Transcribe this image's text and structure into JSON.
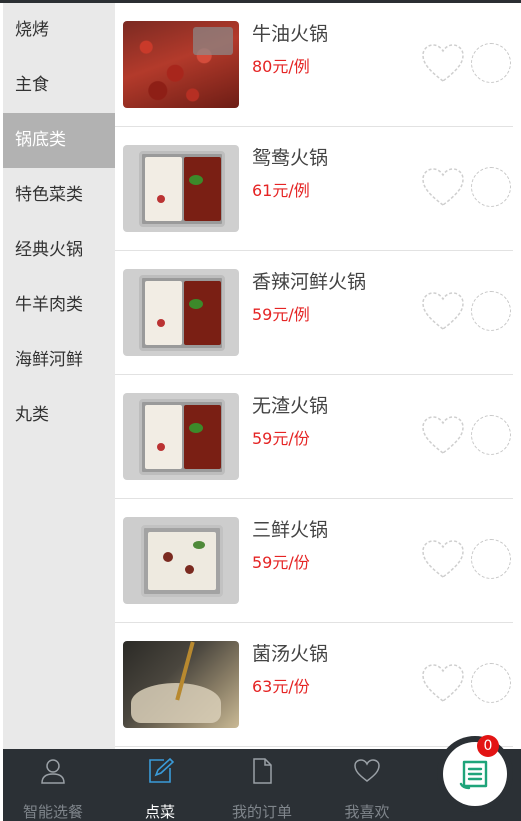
{
  "sidebar": {
    "categories": [
      {
        "label": "烧烤"
      },
      {
        "label": "主食"
      },
      {
        "label": "锅底类"
      },
      {
        "label": "特色菜类"
      },
      {
        "label": "经典火锅"
      },
      {
        "label": "牛羊肉类"
      },
      {
        "label": "海鲜河鲜"
      },
      {
        "label": "丸类"
      }
    ],
    "active": "锅底类"
  },
  "dishes": [
    {
      "name": "牛油火锅",
      "price": "80元/例",
      "image": "crayfish-hotpot-photo"
    },
    {
      "name": "鸳鸯火锅",
      "price": "61元/例",
      "image": "yuanyang-hotpot-photo"
    },
    {
      "name": "香辣河鲜火锅",
      "price": "59元/例",
      "image": "yuanyang-hotpot-photo"
    },
    {
      "name": "无渣火锅",
      "price": "59元/份",
      "image": "yuanyang-hotpot-photo"
    },
    {
      "name": "三鲜火锅",
      "price": "59元/份",
      "image": "sanxian-hotpot-photo"
    },
    {
      "name": "菌汤火锅",
      "price": "63元/份",
      "image": "mushroom-soup-photo"
    }
  ],
  "bottom_nav": {
    "items": [
      {
        "label": "智能选餐",
        "icon": "person-icon"
      },
      {
        "label": "点菜",
        "icon": "edit-icon"
      },
      {
        "label": "我的订单",
        "icon": "document-icon"
      },
      {
        "label": "我喜欢",
        "icon": "heart-icon"
      }
    ],
    "active": "点菜"
  },
  "cart": {
    "count": "0",
    "icon": "cart-list-icon"
  },
  "colors": {
    "accent": "#3a9bd9",
    "price": "#e52424",
    "cart_icon": "#1fa47a",
    "badge": "#e31414",
    "nav_bg": "#2b3035"
  }
}
